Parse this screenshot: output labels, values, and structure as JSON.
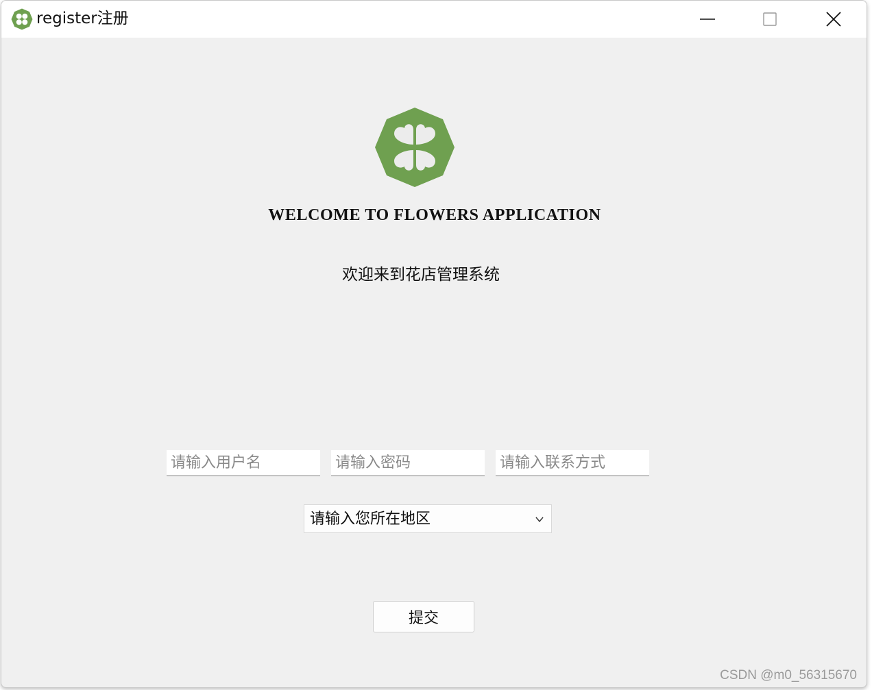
{
  "window": {
    "title": "register注册",
    "app_icon": "four-leaf-clover-icon",
    "controls": {
      "minimize": "minimize-icon",
      "maximize": "maximize-icon",
      "close": "close-icon"
    }
  },
  "main": {
    "logo_icon": "four-leaf-clover-logo",
    "welcome_heading": "WELCOME TO FLOWERS APPLICATION",
    "subtitle": "欢迎来到花店管理系统",
    "form": {
      "username": {
        "placeholder": "请输入用户名",
        "value": ""
      },
      "password": {
        "placeholder": "请输入密码",
        "value": ""
      },
      "contact": {
        "placeholder": "请输入联系方式",
        "value": ""
      },
      "region_select": {
        "selected": "请输入您所在地区"
      },
      "submit_label": "提交"
    }
  },
  "watermark": "CSDN @m0_56315670",
  "colors": {
    "brand_green": "#6fa050",
    "window_bg": "#f0f0f0"
  }
}
